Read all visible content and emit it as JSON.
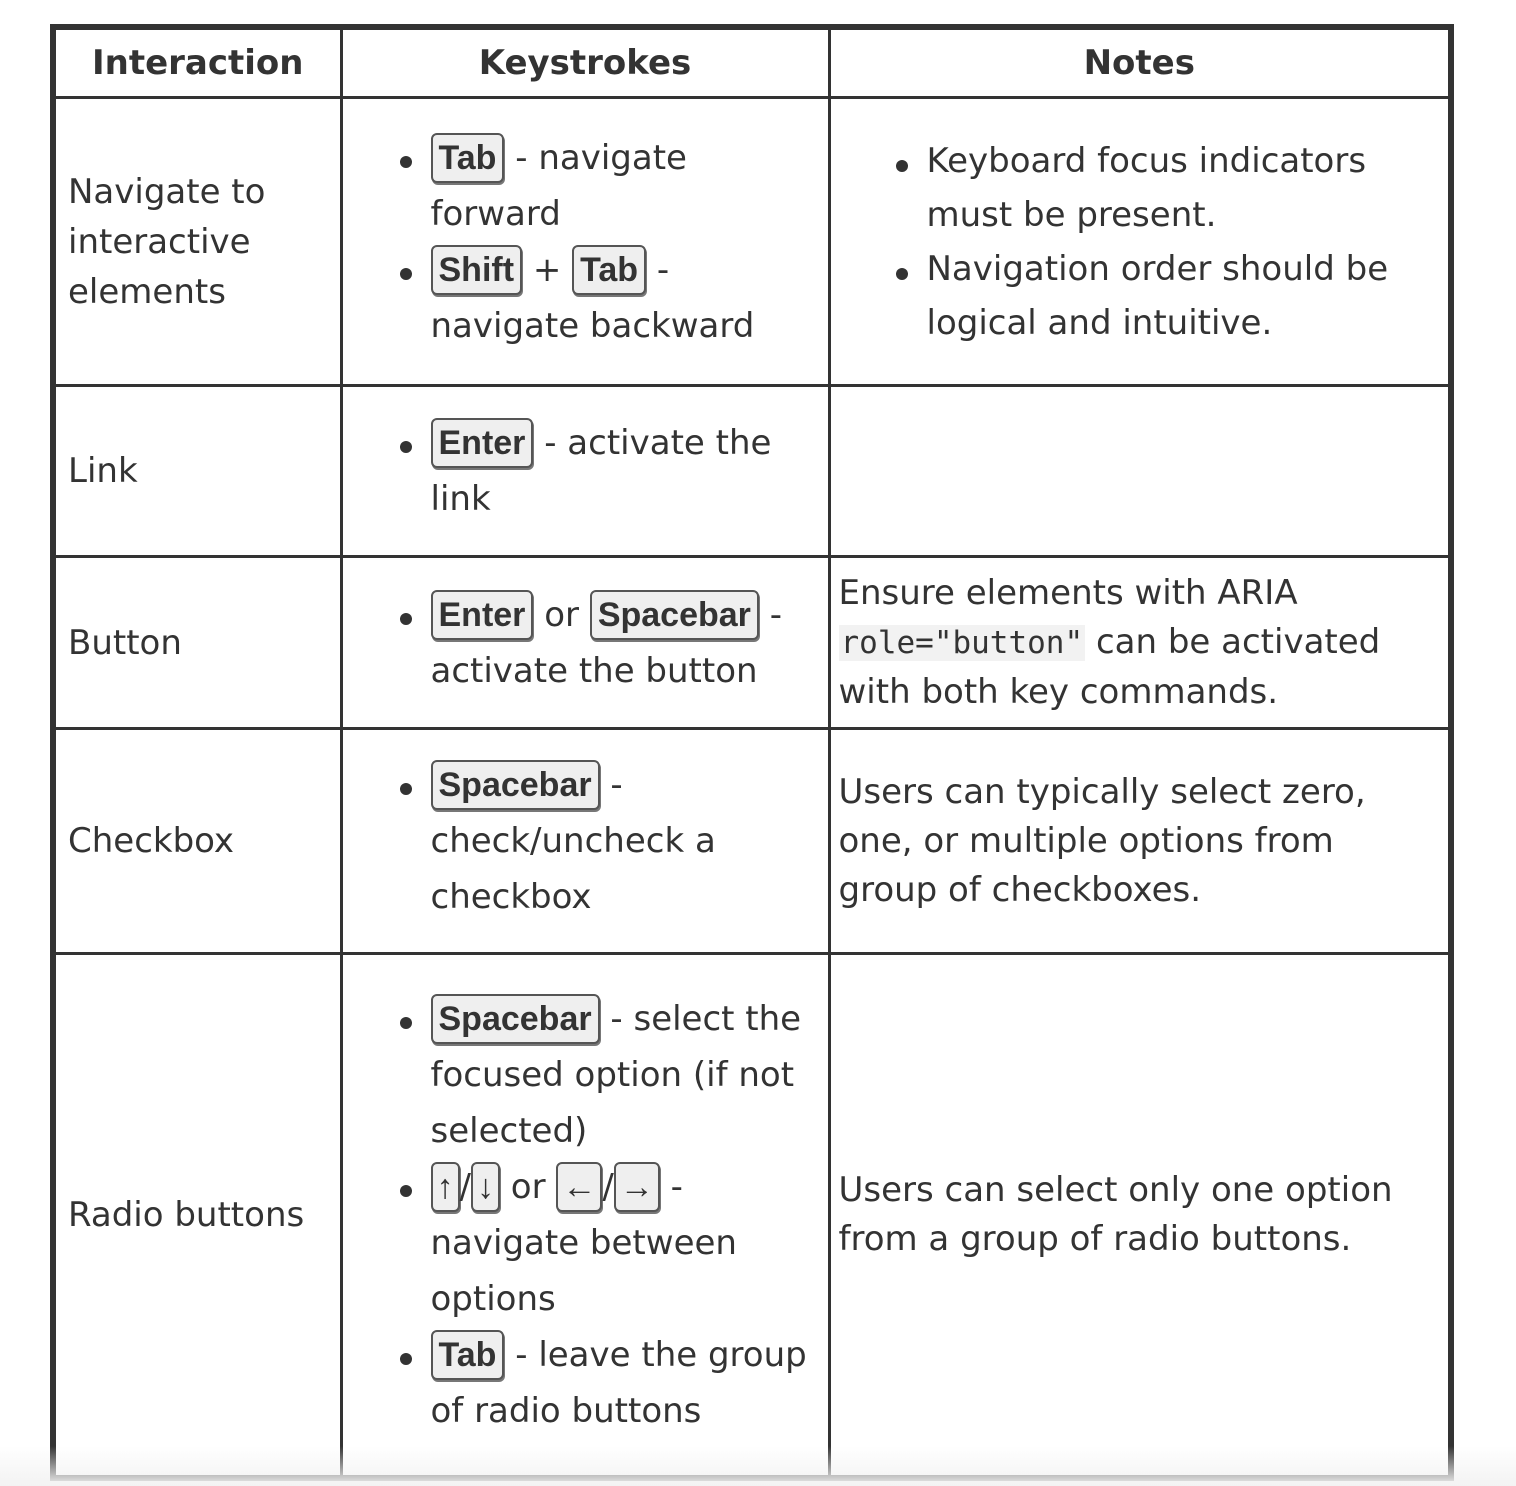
{
  "table": {
    "headers": [
      "Interaction",
      "Keystrokes",
      "Notes"
    ],
    "rows": [
      {
        "interaction": "Navigate to interactive elements",
        "keystrokes": [
          {
            "keys": [
              "Tab"
            ],
            "joiners": [],
            "text": " - navigate forward"
          },
          {
            "keys": [
              "Shift",
              "Tab"
            ],
            "joiners": [
              " + "
            ],
            "text": " - navigate backward"
          }
        ],
        "notes_list": [
          "Keyboard focus indicators must be present.",
          "Navigation order should be logical and intuitive."
        ]
      },
      {
        "interaction": "Link",
        "keystrokes": [
          {
            "keys": [
              "Enter"
            ],
            "joiners": [],
            "text": " - activate the link"
          }
        ]
      },
      {
        "interaction": "Button",
        "keystrokes": [
          {
            "keys": [
              "Enter",
              "Spacebar"
            ],
            "joiners": [
              " or "
            ],
            "text": " - activate the button"
          }
        ],
        "notes": {
          "before": "Ensure elements with ARIA ",
          "code": "role=\"button\"",
          "after": " can be activated with both key commands."
        }
      },
      {
        "interaction": "Checkbox",
        "keystrokes": [
          {
            "keys": [
              "Spacebar"
            ],
            "joiners": [],
            "text": " - check/uncheck a checkbox"
          }
        ],
        "notes": {
          "text": "Users can typically select zero, one, or multiple options from group of checkboxes."
        }
      },
      {
        "interaction": "Radio buttons",
        "keystrokes": [
          {
            "keys": [
              "Spacebar"
            ],
            "joiners": [],
            "text": " - select the focused option (if not selected)"
          },
          {
            "keys": [
              "↑",
              "↓",
              "←",
              "→"
            ],
            "joiners": [
              "/",
              " or ",
              "/"
            ],
            "text": " - navigate between options",
            "arrow": true
          },
          {
            "keys": [
              "Tab"
            ],
            "joiners": [],
            "text": " - leave the group of radio buttons"
          }
        ],
        "notes": {
          "text": "Users can select only one option from a group of radio buttons."
        }
      }
    ]
  }
}
